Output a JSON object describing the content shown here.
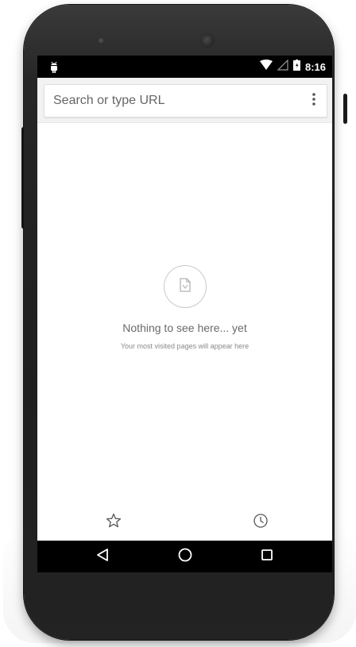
{
  "status_bar": {
    "time": "8:16",
    "icons": [
      "android-debug-icon",
      "wifi-icon",
      "signal-icon",
      "battery-icon"
    ]
  },
  "toolbar": {
    "search_placeholder": "Search or type URL",
    "menu_icon": "overflow-menu-icon"
  },
  "empty_state": {
    "icon": "page-icon",
    "title": "Nothing to see here... yet",
    "subtitle": "Your most visited pages will appear here"
  },
  "bottom_bar": {
    "items": [
      {
        "icon": "bookmark-star-icon"
      },
      {
        "icon": "history-clock-icon"
      }
    ]
  },
  "nav_bar": {
    "items": [
      {
        "icon": "back-icon"
      },
      {
        "icon": "home-icon"
      },
      {
        "icon": "recents-icon"
      }
    ]
  },
  "colors": {
    "status_bar": "#000000",
    "toolbar": "#f2f2f2",
    "screen": "#ffffff",
    "text": "#6a6a6a",
    "phone_body": "#222222"
  }
}
